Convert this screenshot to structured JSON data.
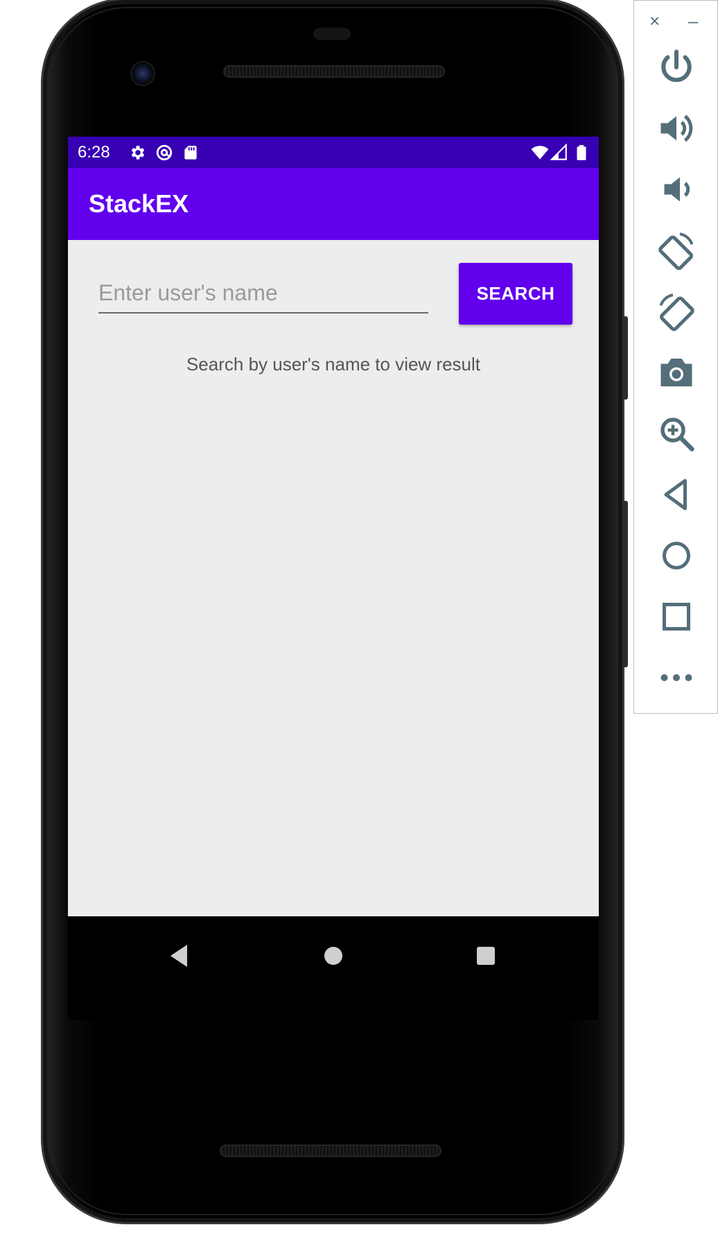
{
  "status_bar": {
    "time": "6:28",
    "left_icons": [
      "gear-icon",
      "at-sign-icon",
      "sd-card-icon"
    ],
    "right_icons": [
      "wifi-icon",
      "signal-icon",
      "battery-icon"
    ],
    "color": "#3700b3"
  },
  "app_bar": {
    "title": "StackEX",
    "color": "#6200ee"
  },
  "search": {
    "placeholder": "Enter user's name",
    "value": "",
    "button_label": "SEARCH"
  },
  "hint": "Search by user's name to view result",
  "nav_bar": {
    "buttons": [
      "back-triangle-icon",
      "home-circle-icon",
      "recents-square-icon"
    ]
  },
  "emulator_toolbar": {
    "close": "×",
    "minimize": "–",
    "buttons": [
      "power-icon",
      "volume-up-icon",
      "volume-down-icon",
      "rotate-left-icon",
      "rotate-right-icon",
      "camera-icon",
      "zoom-icon",
      "back-icon",
      "home-icon",
      "overview-icon",
      "more-icon"
    ],
    "icon_color": "#546e7a"
  }
}
